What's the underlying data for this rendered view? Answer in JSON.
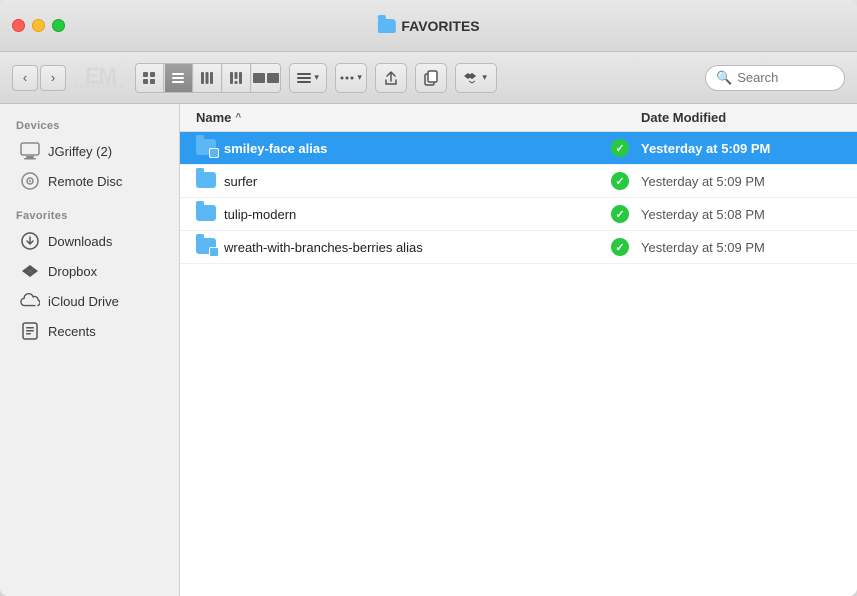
{
  "window": {
    "title": "FAVORITES",
    "traffic_lights": [
      "close",
      "minimize",
      "maximize"
    ]
  },
  "toolbar": {
    "back_label": "‹",
    "forward_label": "›",
    "logo_text": "EM",
    "logo_sub": "DIGITIZER",
    "search_placeholder": "Search",
    "view_buttons": [
      "icon-view",
      "list-view",
      "column-view",
      "gallery-view",
      "arrange-view"
    ],
    "action_buttons": [
      "gear",
      "share",
      "copy",
      "arrange"
    ]
  },
  "sidebar": {
    "devices_header": "Devices",
    "devices": [
      {
        "label": "JGriffey (2)",
        "icon": "computer"
      },
      {
        "label": "Remote Disc",
        "icon": "disc"
      }
    ],
    "favorites_header": "Favorites",
    "favorites": [
      {
        "label": "Downloads",
        "icon": "downloads"
      },
      {
        "label": "Dropbox",
        "icon": "dropbox"
      },
      {
        "label": "iCloud Drive",
        "icon": "icloud"
      },
      {
        "label": "Recents",
        "icon": "recents"
      }
    ]
  },
  "file_list": {
    "col_name": "Name",
    "col_date": "Date Modified",
    "sort_arrow": "^",
    "files": [
      {
        "name": "smiley-face alias",
        "date": "Yesterday at 5:09 PM",
        "type": "folder-alias",
        "status": "synced",
        "selected": true
      },
      {
        "name": "surfer",
        "date": "Yesterday at 5:09 PM",
        "type": "folder",
        "status": "synced",
        "selected": false
      },
      {
        "name": "tulip-modern",
        "date": "Yesterday at 5:08 PM",
        "type": "folder",
        "status": "synced",
        "selected": false
      },
      {
        "name": "wreath-with-branches-berries alias",
        "date": "Yesterday at 5:09 PM",
        "type": "folder-alias",
        "status": "synced",
        "selected": false
      }
    ]
  },
  "colors": {
    "selected_bg": "#2d9bf0",
    "folder_color": "#5bb8f5",
    "synced_green": "#27c93f"
  }
}
